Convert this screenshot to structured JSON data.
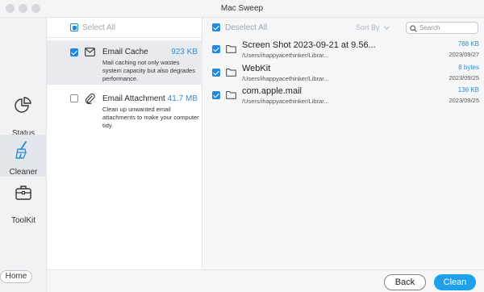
{
  "window": {
    "title": "Mac Sweep"
  },
  "sidebar": {
    "items": [
      {
        "label": "Status",
        "icon": "pie-chart-icon",
        "active": false
      },
      {
        "label": "Cleaner",
        "icon": "broom-icon",
        "active": true
      },
      {
        "label": "ToolKit",
        "icon": "toolbox-icon",
        "active": false
      }
    ],
    "home_label": "Home"
  },
  "categories": {
    "select_all_label": "Select All",
    "items": [
      {
        "name": "Email Cache",
        "size": "923 KB",
        "checked": true,
        "icon": "envelope-icon",
        "description": "Mail caching not only wastes system capacity but also degrades performance."
      },
      {
        "name": "Email Attachment",
        "size": "41.7 MB",
        "checked": false,
        "icon": "paperclip-icon",
        "description": "Clean up unwanted email attachments to make your computer tidy."
      }
    ]
  },
  "files": {
    "deselect_all_label": "Deselect All",
    "sort_label": "Sort By",
    "search_placeholder": "Search",
    "items": [
      {
        "name": "Screen Shot 2023-09-21 at 9.56...",
        "path": "/Users/ihappyacethinker/Librar...",
        "size": "788 KB",
        "date": "2023/09/27",
        "checked": true
      },
      {
        "name": "WebKit",
        "path": "/Users/ihappyacethinker/Librar...",
        "size": "8 bytes",
        "date": "2023/09/25",
        "checked": true
      },
      {
        "name": "com.apple.mail",
        "path": "/Users/ihappyacethinker/Librar...",
        "size": "136 KB",
        "date": "2023/09/25",
        "checked": true
      }
    ]
  },
  "footer": {
    "back_label": "Back",
    "clean_label": "Clean"
  },
  "colors": {
    "accent": "#1ea0ea",
    "checkbox": "#1e88e5",
    "size_text": "#2b8fd6"
  }
}
